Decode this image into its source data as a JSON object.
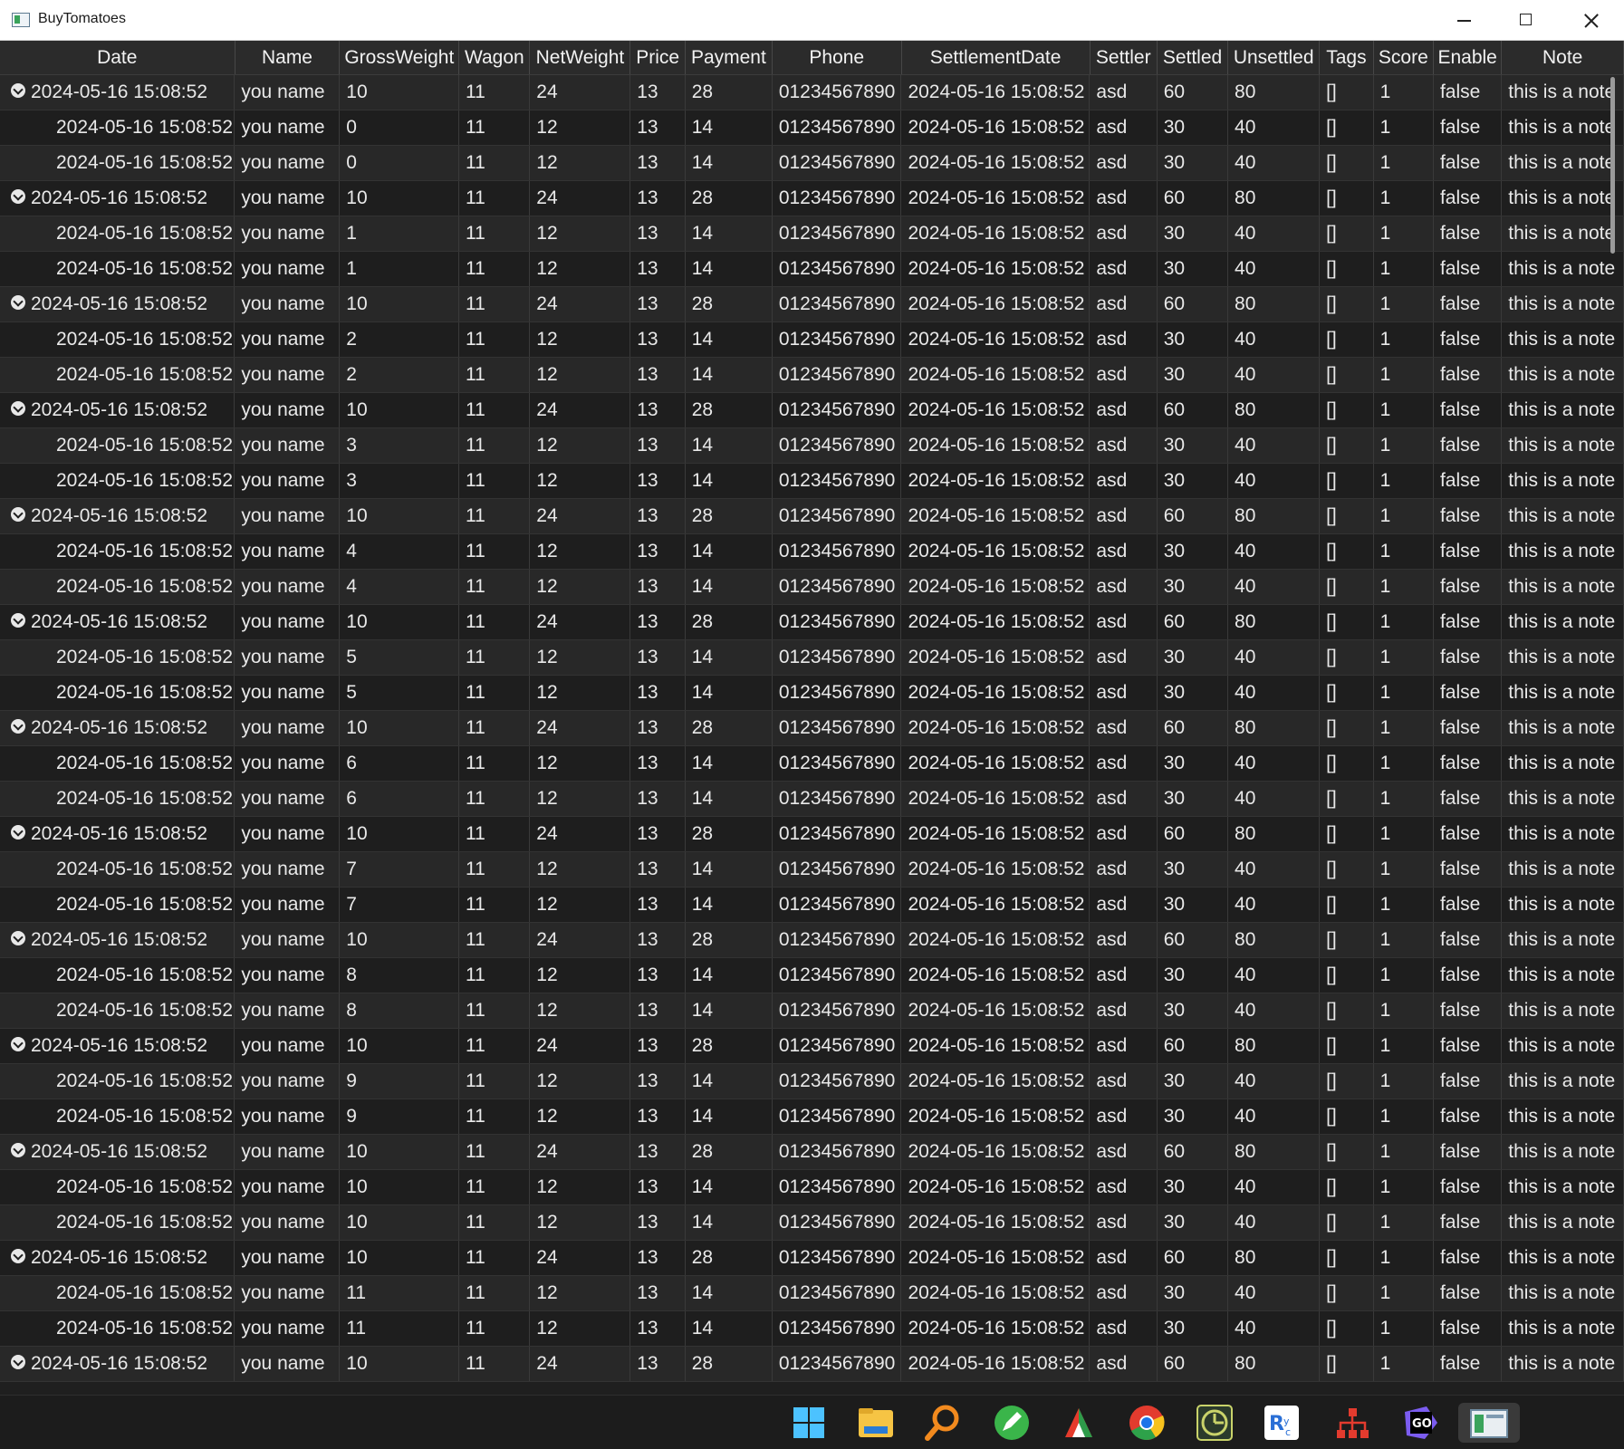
{
  "window": {
    "title": "BuyTomatoes"
  },
  "columns": [
    "Date",
    "Name",
    "GrossWeight",
    "Wagon",
    "NetWeight",
    "Price",
    "Payment",
    "Phone",
    "SettlementDate",
    "Settler",
    "Settled",
    "Unsettled",
    "Tags",
    "Score",
    "Enable",
    "Note"
  ],
  "rows": [
    {
      "group": true,
      "date": "2024-05-16 15:08:52",
      "name": "you name",
      "gross": "10",
      "wagon": "11",
      "net": "24",
      "price": "13",
      "payment": "28",
      "phone": "01234567890",
      "settlement": "2024-05-16 15:08:52",
      "settler": "asd",
      "settled": "60",
      "unsettled": "80",
      "tags": "[]",
      "score": "1",
      "enable": "false",
      "note": "this is a note"
    },
    {
      "group": false,
      "date": "2024-05-16 15:08:52",
      "name": "you name",
      "gross": "0",
      "wagon": "11",
      "net": "12",
      "price": "13",
      "payment": "14",
      "phone": "01234567890",
      "settlement": "2024-05-16 15:08:52",
      "settler": "asd",
      "settled": "30",
      "unsettled": "40",
      "tags": "[]",
      "score": "1",
      "enable": "false",
      "note": "this is a note"
    },
    {
      "group": false,
      "date": "2024-05-16 15:08:52",
      "name": "you name",
      "gross": "0",
      "wagon": "11",
      "net": "12",
      "price": "13",
      "payment": "14",
      "phone": "01234567890",
      "settlement": "2024-05-16 15:08:52",
      "settler": "asd",
      "settled": "30",
      "unsettled": "40",
      "tags": "[]",
      "score": "1",
      "enable": "false",
      "note": "this is a note"
    },
    {
      "group": true,
      "date": "2024-05-16 15:08:52",
      "name": "you name",
      "gross": "10",
      "wagon": "11",
      "net": "24",
      "price": "13",
      "payment": "28",
      "phone": "01234567890",
      "settlement": "2024-05-16 15:08:52",
      "settler": "asd",
      "settled": "60",
      "unsettled": "80",
      "tags": "[]",
      "score": "1",
      "enable": "false",
      "note": "this is a note"
    },
    {
      "group": false,
      "date": "2024-05-16 15:08:52",
      "name": "you name",
      "gross": "1",
      "wagon": "11",
      "net": "12",
      "price": "13",
      "payment": "14",
      "phone": "01234567890",
      "settlement": "2024-05-16 15:08:52",
      "settler": "asd",
      "settled": "30",
      "unsettled": "40",
      "tags": "[]",
      "score": "1",
      "enable": "false",
      "note": "this is a note"
    },
    {
      "group": false,
      "date": "2024-05-16 15:08:52",
      "name": "you name",
      "gross": "1",
      "wagon": "11",
      "net": "12",
      "price": "13",
      "payment": "14",
      "phone": "01234567890",
      "settlement": "2024-05-16 15:08:52",
      "settler": "asd",
      "settled": "30",
      "unsettled": "40",
      "tags": "[]",
      "score": "1",
      "enable": "false",
      "note": "this is a note"
    },
    {
      "group": true,
      "date": "2024-05-16 15:08:52",
      "name": "you name",
      "gross": "10",
      "wagon": "11",
      "net": "24",
      "price": "13",
      "payment": "28",
      "phone": "01234567890",
      "settlement": "2024-05-16 15:08:52",
      "settler": "asd",
      "settled": "60",
      "unsettled": "80",
      "tags": "[]",
      "score": "1",
      "enable": "false",
      "note": "this is a note"
    },
    {
      "group": false,
      "date": "2024-05-16 15:08:52",
      "name": "you name",
      "gross": "2",
      "wagon": "11",
      "net": "12",
      "price": "13",
      "payment": "14",
      "phone": "01234567890",
      "settlement": "2024-05-16 15:08:52",
      "settler": "asd",
      "settled": "30",
      "unsettled": "40",
      "tags": "[]",
      "score": "1",
      "enable": "false",
      "note": "this is a note"
    },
    {
      "group": false,
      "date": "2024-05-16 15:08:52",
      "name": "you name",
      "gross": "2",
      "wagon": "11",
      "net": "12",
      "price": "13",
      "payment": "14",
      "phone": "01234567890",
      "settlement": "2024-05-16 15:08:52",
      "settler": "asd",
      "settled": "30",
      "unsettled": "40",
      "tags": "[]",
      "score": "1",
      "enable": "false",
      "note": "this is a note"
    },
    {
      "group": true,
      "date": "2024-05-16 15:08:52",
      "name": "you name",
      "gross": "10",
      "wagon": "11",
      "net": "24",
      "price": "13",
      "payment": "28",
      "phone": "01234567890",
      "settlement": "2024-05-16 15:08:52",
      "settler": "asd",
      "settled": "60",
      "unsettled": "80",
      "tags": "[]",
      "score": "1",
      "enable": "false",
      "note": "this is a note"
    },
    {
      "group": false,
      "date": "2024-05-16 15:08:52",
      "name": "you name",
      "gross": "3",
      "wagon": "11",
      "net": "12",
      "price": "13",
      "payment": "14",
      "phone": "01234567890",
      "settlement": "2024-05-16 15:08:52",
      "settler": "asd",
      "settled": "30",
      "unsettled": "40",
      "tags": "[]",
      "score": "1",
      "enable": "false",
      "note": "this is a note"
    },
    {
      "group": false,
      "date": "2024-05-16 15:08:52",
      "name": "you name",
      "gross": "3",
      "wagon": "11",
      "net": "12",
      "price": "13",
      "payment": "14",
      "phone": "01234567890",
      "settlement": "2024-05-16 15:08:52",
      "settler": "asd",
      "settled": "30",
      "unsettled": "40",
      "tags": "[]",
      "score": "1",
      "enable": "false",
      "note": "this is a note"
    },
    {
      "group": true,
      "date": "2024-05-16 15:08:52",
      "name": "you name",
      "gross": "10",
      "wagon": "11",
      "net": "24",
      "price": "13",
      "payment": "28",
      "phone": "01234567890",
      "settlement": "2024-05-16 15:08:52",
      "settler": "asd",
      "settled": "60",
      "unsettled": "80",
      "tags": "[]",
      "score": "1",
      "enable": "false",
      "note": "this is a note"
    },
    {
      "group": false,
      "date": "2024-05-16 15:08:52",
      "name": "you name",
      "gross": "4",
      "wagon": "11",
      "net": "12",
      "price": "13",
      "payment": "14",
      "phone": "01234567890",
      "settlement": "2024-05-16 15:08:52",
      "settler": "asd",
      "settled": "30",
      "unsettled": "40",
      "tags": "[]",
      "score": "1",
      "enable": "false",
      "note": "this is a note"
    },
    {
      "group": false,
      "date": "2024-05-16 15:08:52",
      "name": "you name",
      "gross": "4",
      "wagon": "11",
      "net": "12",
      "price": "13",
      "payment": "14",
      "phone": "01234567890",
      "settlement": "2024-05-16 15:08:52",
      "settler": "asd",
      "settled": "30",
      "unsettled": "40",
      "tags": "[]",
      "score": "1",
      "enable": "false",
      "note": "this is a note"
    },
    {
      "group": true,
      "date": "2024-05-16 15:08:52",
      "name": "you name",
      "gross": "10",
      "wagon": "11",
      "net": "24",
      "price": "13",
      "payment": "28",
      "phone": "01234567890",
      "settlement": "2024-05-16 15:08:52",
      "settler": "asd",
      "settled": "60",
      "unsettled": "80",
      "tags": "[]",
      "score": "1",
      "enable": "false",
      "note": "this is a note"
    },
    {
      "group": false,
      "date": "2024-05-16 15:08:52",
      "name": "you name",
      "gross": "5",
      "wagon": "11",
      "net": "12",
      "price": "13",
      "payment": "14",
      "phone": "01234567890",
      "settlement": "2024-05-16 15:08:52",
      "settler": "asd",
      "settled": "30",
      "unsettled": "40",
      "tags": "[]",
      "score": "1",
      "enable": "false",
      "note": "this is a note"
    },
    {
      "group": false,
      "date": "2024-05-16 15:08:52",
      "name": "you name",
      "gross": "5",
      "wagon": "11",
      "net": "12",
      "price": "13",
      "payment": "14",
      "phone": "01234567890",
      "settlement": "2024-05-16 15:08:52",
      "settler": "asd",
      "settled": "30",
      "unsettled": "40",
      "tags": "[]",
      "score": "1",
      "enable": "false",
      "note": "this is a note"
    },
    {
      "group": true,
      "date": "2024-05-16 15:08:52",
      "name": "you name",
      "gross": "10",
      "wagon": "11",
      "net": "24",
      "price": "13",
      "payment": "28",
      "phone": "01234567890",
      "settlement": "2024-05-16 15:08:52",
      "settler": "asd",
      "settled": "60",
      "unsettled": "80",
      "tags": "[]",
      "score": "1",
      "enable": "false",
      "note": "this is a note"
    },
    {
      "group": false,
      "date": "2024-05-16 15:08:52",
      "name": "you name",
      "gross": "6",
      "wagon": "11",
      "net": "12",
      "price": "13",
      "payment": "14",
      "phone": "01234567890",
      "settlement": "2024-05-16 15:08:52",
      "settler": "asd",
      "settled": "30",
      "unsettled": "40",
      "tags": "[]",
      "score": "1",
      "enable": "false",
      "note": "this is a note"
    },
    {
      "group": false,
      "date": "2024-05-16 15:08:52",
      "name": "you name",
      "gross": "6",
      "wagon": "11",
      "net": "12",
      "price": "13",
      "payment": "14",
      "phone": "01234567890",
      "settlement": "2024-05-16 15:08:52",
      "settler": "asd",
      "settled": "30",
      "unsettled": "40",
      "tags": "[]",
      "score": "1",
      "enable": "false",
      "note": "this is a note"
    },
    {
      "group": true,
      "date": "2024-05-16 15:08:52",
      "name": "you name",
      "gross": "10",
      "wagon": "11",
      "net": "24",
      "price": "13",
      "payment": "28",
      "phone": "01234567890",
      "settlement": "2024-05-16 15:08:52",
      "settler": "asd",
      "settled": "60",
      "unsettled": "80",
      "tags": "[]",
      "score": "1",
      "enable": "false",
      "note": "this is a note"
    },
    {
      "group": false,
      "date": "2024-05-16 15:08:52",
      "name": "you name",
      "gross": "7",
      "wagon": "11",
      "net": "12",
      "price": "13",
      "payment": "14",
      "phone": "01234567890",
      "settlement": "2024-05-16 15:08:52",
      "settler": "asd",
      "settled": "30",
      "unsettled": "40",
      "tags": "[]",
      "score": "1",
      "enable": "false",
      "note": "this is a note"
    },
    {
      "group": false,
      "date": "2024-05-16 15:08:52",
      "name": "you name",
      "gross": "7",
      "wagon": "11",
      "net": "12",
      "price": "13",
      "payment": "14",
      "phone": "01234567890",
      "settlement": "2024-05-16 15:08:52",
      "settler": "asd",
      "settled": "30",
      "unsettled": "40",
      "tags": "[]",
      "score": "1",
      "enable": "false",
      "note": "this is a note"
    },
    {
      "group": true,
      "date": "2024-05-16 15:08:52",
      "name": "you name",
      "gross": "10",
      "wagon": "11",
      "net": "24",
      "price": "13",
      "payment": "28",
      "phone": "01234567890",
      "settlement": "2024-05-16 15:08:52",
      "settler": "asd",
      "settled": "60",
      "unsettled": "80",
      "tags": "[]",
      "score": "1",
      "enable": "false",
      "note": "this is a note"
    },
    {
      "group": false,
      "date": "2024-05-16 15:08:52",
      "name": "you name",
      "gross": "8",
      "wagon": "11",
      "net": "12",
      "price": "13",
      "payment": "14",
      "phone": "01234567890",
      "settlement": "2024-05-16 15:08:52",
      "settler": "asd",
      "settled": "30",
      "unsettled": "40",
      "tags": "[]",
      "score": "1",
      "enable": "false",
      "note": "this is a note"
    },
    {
      "group": false,
      "date": "2024-05-16 15:08:52",
      "name": "you name",
      "gross": "8",
      "wagon": "11",
      "net": "12",
      "price": "13",
      "payment": "14",
      "phone": "01234567890",
      "settlement": "2024-05-16 15:08:52",
      "settler": "asd",
      "settled": "30",
      "unsettled": "40",
      "tags": "[]",
      "score": "1",
      "enable": "false",
      "note": "this is a note"
    },
    {
      "group": true,
      "date": "2024-05-16 15:08:52",
      "name": "you name",
      "gross": "10",
      "wagon": "11",
      "net": "24",
      "price": "13",
      "payment": "28",
      "phone": "01234567890",
      "settlement": "2024-05-16 15:08:52",
      "settler": "asd",
      "settled": "60",
      "unsettled": "80",
      "tags": "[]",
      "score": "1",
      "enable": "false",
      "note": "this is a note"
    },
    {
      "group": false,
      "date": "2024-05-16 15:08:52",
      "name": "you name",
      "gross": "9",
      "wagon": "11",
      "net": "12",
      "price": "13",
      "payment": "14",
      "phone": "01234567890",
      "settlement": "2024-05-16 15:08:52",
      "settler": "asd",
      "settled": "30",
      "unsettled": "40",
      "tags": "[]",
      "score": "1",
      "enable": "false",
      "note": "this is a note"
    },
    {
      "group": false,
      "date": "2024-05-16 15:08:52",
      "name": "you name",
      "gross": "9",
      "wagon": "11",
      "net": "12",
      "price": "13",
      "payment": "14",
      "phone": "01234567890",
      "settlement": "2024-05-16 15:08:52",
      "settler": "asd",
      "settled": "30",
      "unsettled": "40",
      "tags": "[]",
      "score": "1",
      "enable": "false",
      "note": "this is a note"
    },
    {
      "group": true,
      "date": "2024-05-16 15:08:52",
      "name": "you name",
      "gross": "10",
      "wagon": "11",
      "net": "24",
      "price": "13",
      "payment": "28",
      "phone": "01234567890",
      "settlement": "2024-05-16 15:08:52",
      "settler": "asd",
      "settled": "60",
      "unsettled": "80",
      "tags": "[]",
      "score": "1",
      "enable": "false",
      "note": "this is a note"
    },
    {
      "group": false,
      "date": "2024-05-16 15:08:52",
      "name": "you name",
      "gross": "10",
      "wagon": "11",
      "net": "12",
      "price": "13",
      "payment": "14",
      "phone": "01234567890",
      "settlement": "2024-05-16 15:08:52",
      "settler": "asd",
      "settled": "30",
      "unsettled": "40",
      "tags": "[]",
      "score": "1",
      "enable": "false",
      "note": "this is a note"
    },
    {
      "group": false,
      "date": "2024-05-16 15:08:52",
      "name": "you name",
      "gross": "10",
      "wagon": "11",
      "net": "12",
      "price": "13",
      "payment": "14",
      "phone": "01234567890",
      "settlement": "2024-05-16 15:08:52",
      "settler": "asd",
      "settled": "30",
      "unsettled": "40",
      "tags": "[]",
      "score": "1",
      "enable": "false",
      "note": "this is a note"
    },
    {
      "group": true,
      "date": "2024-05-16 15:08:52",
      "name": "you name",
      "gross": "10",
      "wagon": "11",
      "net": "24",
      "price": "13",
      "payment": "28",
      "phone": "01234567890",
      "settlement": "2024-05-16 15:08:52",
      "settler": "asd",
      "settled": "60",
      "unsettled": "80",
      "tags": "[]",
      "score": "1",
      "enable": "false",
      "note": "this is a note"
    },
    {
      "group": false,
      "date": "2024-05-16 15:08:52",
      "name": "you name",
      "gross": "11",
      "wagon": "11",
      "net": "12",
      "price": "13",
      "payment": "14",
      "phone": "01234567890",
      "settlement": "2024-05-16 15:08:52",
      "settler": "asd",
      "settled": "30",
      "unsettled": "40",
      "tags": "[]",
      "score": "1",
      "enable": "false",
      "note": "this is a note"
    },
    {
      "group": false,
      "date": "2024-05-16 15:08:52",
      "name": "you name",
      "gross": "11",
      "wagon": "11",
      "net": "12",
      "price": "13",
      "payment": "14",
      "phone": "01234567890",
      "settlement": "2024-05-16 15:08:52",
      "settler": "asd",
      "settled": "30",
      "unsettled": "40",
      "tags": "[]",
      "score": "1",
      "enable": "false",
      "note": "this is a note"
    },
    {
      "group": true,
      "date": "2024-05-16 15:08:52",
      "name": "you name",
      "gross": "10",
      "wagon": "11",
      "net": "24",
      "price": "13",
      "payment": "28",
      "phone": "01234567890",
      "settlement": "2024-05-16 15:08:52",
      "settler": "asd",
      "settled": "60",
      "unsettled": "80",
      "tags": "[]",
      "score": "1",
      "enable": "false",
      "note": "this is a note"
    }
  ],
  "taskbar": {
    "icons": [
      "windows-start-icon",
      "file-explorer-icon",
      "search-app-icon",
      "notepad-icon",
      "media-player-icon",
      "chrome-icon",
      "clock-app-icon",
      "rider-icon",
      "network-diagram-icon",
      "goland-icon",
      "buytomatoes-app-icon"
    ]
  },
  "colors": {
    "background": "#202020",
    "header": "#2b2b2b",
    "row_odd": "#282828",
    "row_even": "#1e1e1e",
    "text": "#e9e9e9"
  }
}
